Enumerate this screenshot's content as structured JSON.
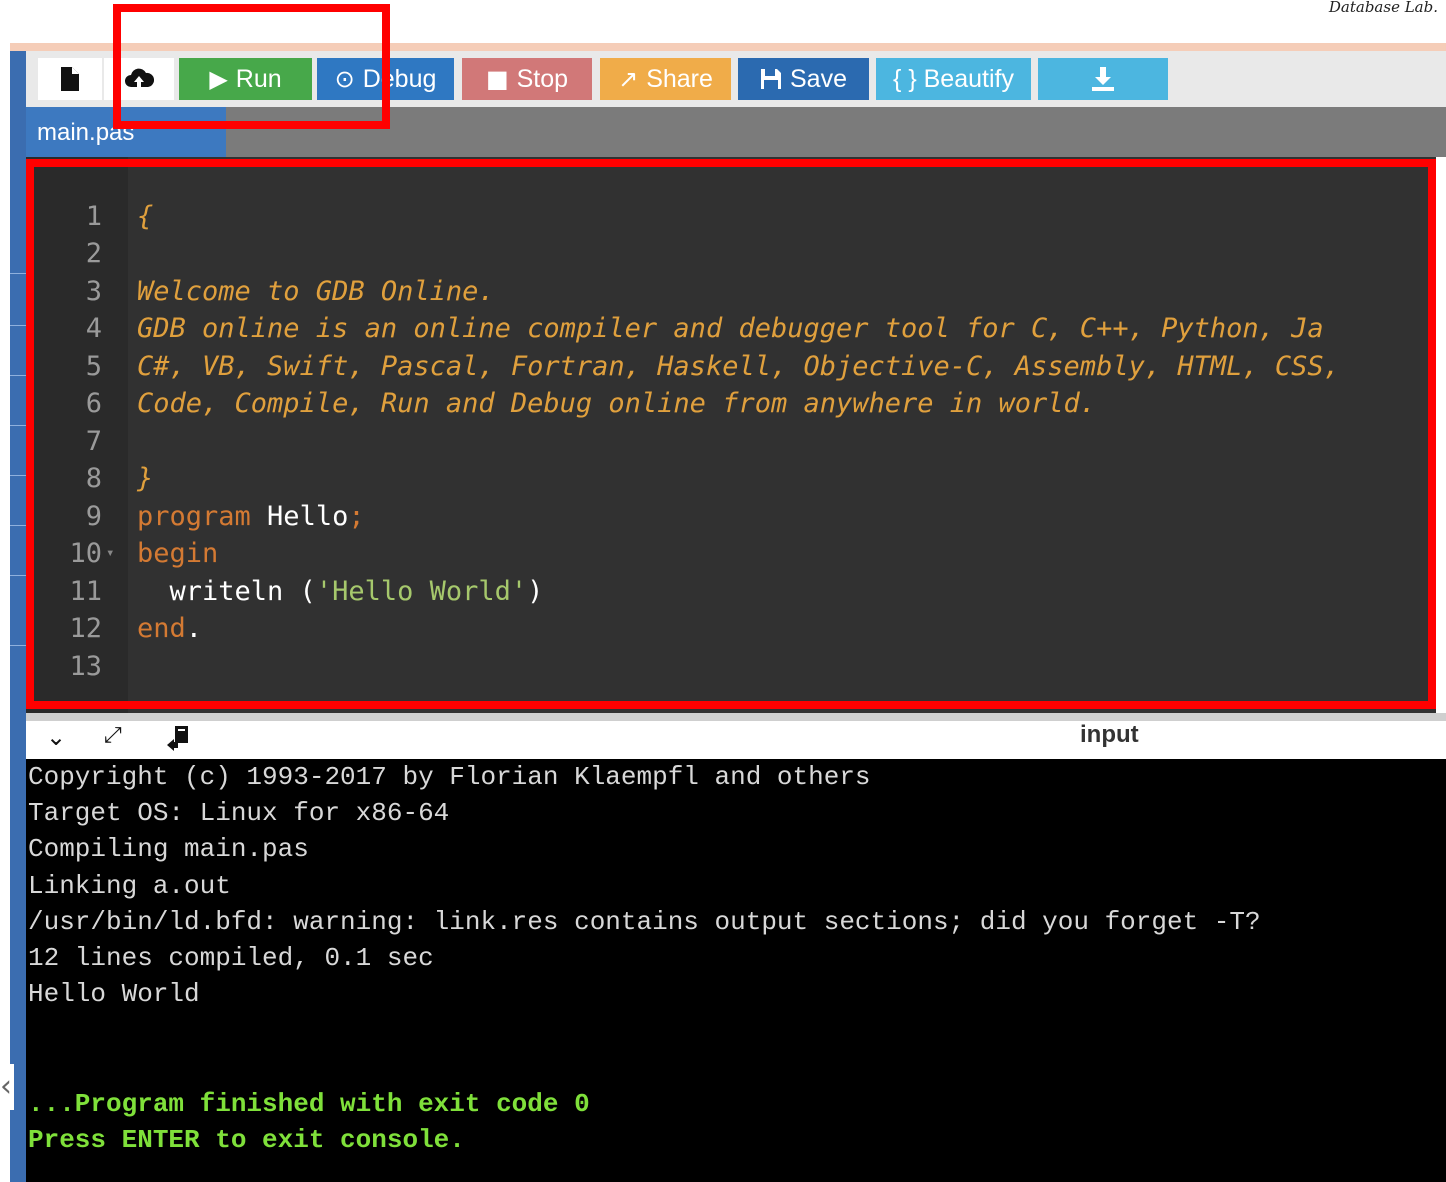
{
  "watermark": "Database Lab.",
  "toolbar": {
    "new_file_icon": "file-icon",
    "upload_icon": "cloud-upload-icon",
    "run_label": "Run",
    "debug_label": "Debug",
    "stop_label": "Stop",
    "share_label": "Share",
    "save_label": "Save",
    "beautify_label": "{ } Beautify",
    "download_icon": "download-icon",
    "colors": {
      "run": "#47a84a",
      "debug": "#2f78c2",
      "stop": "#d17878",
      "share": "#f0ac49",
      "save": "#2b6ab0",
      "beautify": "#4cb6e0",
      "download": "#4cb6e0"
    }
  },
  "file_tab": "main.pas",
  "editor": {
    "lines": [
      {
        "n": "1",
        "text": "{"
      },
      {
        "n": "2",
        "text": ""
      },
      {
        "n": "3",
        "text": "Welcome to GDB Online."
      },
      {
        "n": "4",
        "text": "GDB online is an online compiler and debugger tool for C, C++, Python, Ja"
      },
      {
        "n": "5",
        "text": "C#, VB, Swift, Pascal, Fortran, Haskell, Objective-C, Assembly, HTML, CSS,"
      },
      {
        "n": "6",
        "text": "Code, Compile, Run and Debug online from anywhere in world."
      },
      {
        "n": "7",
        "text": ""
      },
      {
        "n": "8",
        "text": "}"
      },
      {
        "n": "9",
        "kw": "program",
        "name": " Hello",
        "punct": ";"
      },
      {
        "n": "10",
        "kw": "begin"
      },
      {
        "n": "11",
        "indent": "  ",
        "fn": "writeln (",
        "str": "'Hello World'",
        "close": ")"
      },
      {
        "n": "12",
        "kw": "end",
        "punct": "."
      },
      {
        "n": "13",
        "text": ""
      }
    ]
  },
  "output_toolbar": {
    "collapse_icon": "chevron-down-icon",
    "expand_icon": "expand-icon",
    "clear_icon": "clear-console-icon",
    "input_label": "input"
  },
  "console": {
    "lines": [
      "Copyright (c) 1993-2017 by Florian Klaempfl and others",
      "Target OS: Linux for x86-64",
      "Compiling main.pas",
      "Linking a.out",
      "/usr/bin/ld.bfd: warning: link.res contains output sections; did you forget -T?",
      "12 lines compiled, 0.1 sec",
      "Hello World"
    ],
    "finished": "...Program finished with exit code 0",
    "press_enter": "Press ENTER to exit console."
  }
}
